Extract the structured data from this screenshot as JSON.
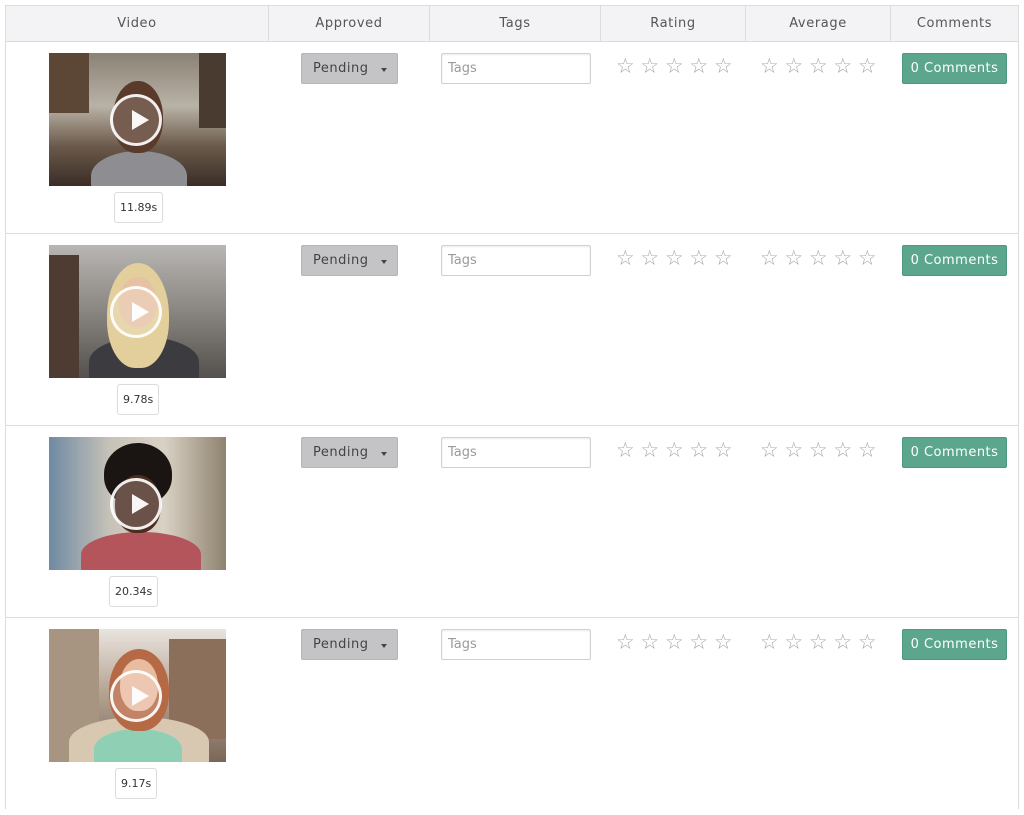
{
  "headers": {
    "video": "Video",
    "approved": "Approved",
    "tags": "Tags",
    "rating": "Rating",
    "average": "Average",
    "comments": "Comments"
  },
  "rows": [
    {
      "duration": "11.89s",
      "status": "Pending",
      "tags_value": "",
      "tags_placeholder": "Tags",
      "rating": 0,
      "average": 0,
      "comments_label": "0 Comments"
    },
    {
      "duration": "9.78s",
      "status": "Pending",
      "tags_value": "",
      "tags_placeholder": "Tags",
      "rating": 0,
      "average": 0,
      "comments_label": "0 Comments"
    },
    {
      "duration": "20.34s",
      "status": "Pending",
      "tags_value": "",
      "tags_placeholder": "Tags",
      "rating": 0,
      "average": 0,
      "comments_label": "0 Comments"
    },
    {
      "duration": "9.17s",
      "status": "Pending",
      "tags_value": "",
      "tags_placeholder": "Tags",
      "rating": 0,
      "average": 0,
      "comments_label": "0 Comments"
    }
  ],
  "icons": {
    "play": "play-icon",
    "caret": "caret-down-icon",
    "star": "star-outline-icon",
    "star_glyph": "☆"
  },
  "colors": {
    "header_bg": "#f3f3f5",
    "select_bg": "#c4c4c6",
    "comments_bg": "#5ba68d",
    "star": "#a9a9a9"
  }
}
